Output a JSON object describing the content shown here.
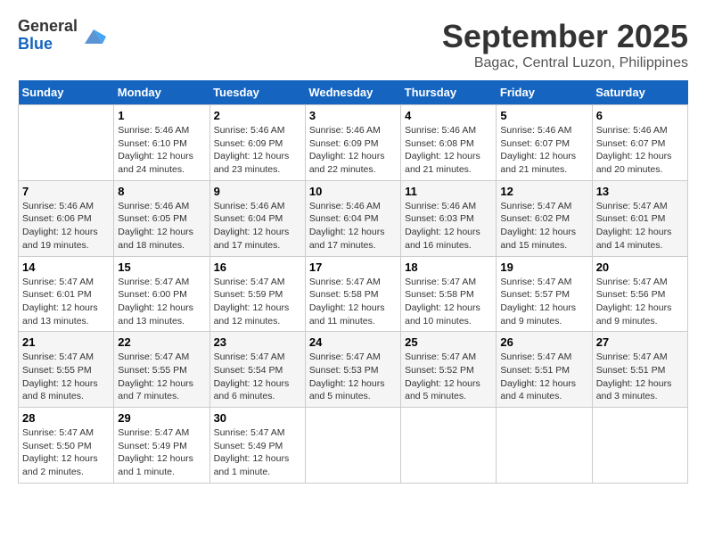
{
  "logo": {
    "general": "General",
    "blue": "Blue"
  },
  "title": {
    "month": "September 2025",
    "location": "Bagac, Central Luzon, Philippines"
  },
  "weekdays": [
    "Sunday",
    "Monday",
    "Tuesday",
    "Wednesday",
    "Thursday",
    "Friday",
    "Saturday"
  ],
  "weeks": [
    [
      {
        "day": "",
        "empty": true
      },
      {
        "day": "1",
        "sunrise": "5:46 AM",
        "sunset": "6:10 PM",
        "daylight": "12 hours and 24 minutes."
      },
      {
        "day": "2",
        "sunrise": "5:46 AM",
        "sunset": "6:09 PM",
        "daylight": "12 hours and 23 minutes."
      },
      {
        "day": "3",
        "sunrise": "5:46 AM",
        "sunset": "6:09 PM",
        "daylight": "12 hours and 22 minutes."
      },
      {
        "day": "4",
        "sunrise": "5:46 AM",
        "sunset": "6:08 PM",
        "daylight": "12 hours and 21 minutes."
      },
      {
        "day": "5",
        "sunrise": "5:46 AM",
        "sunset": "6:07 PM",
        "daylight": "12 hours and 21 minutes."
      },
      {
        "day": "6",
        "sunrise": "5:46 AM",
        "sunset": "6:07 PM",
        "daylight": "12 hours and 20 minutes."
      }
    ],
    [
      {
        "day": "7",
        "sunrise": "5:46 AM",
        "sunset": "6:06 PM",
        "daylight": "12 hours and 19 minutes."
      },
      {
        "day": "8",
        "sunrise": "5:46 AM",
        "sunset": "6:05 PM",
        "daylight": "12 hours and 18 minutes."
      },
      {
        "day": "9",
        "sunrise": "5:46 AM",
        "sunset": "6:04 PM",
        "daylight": "12 hours and 17 minutes."
      },
      {
        "day": "10",
        "sunrise": "5:46 AM",
        "sunset": "6:04 PM",
        "daylight": "12 hours and 17 minutes."
      },
      {
        "day": "11",
        "sunrise": "5:46 AM",
        "sunset": "6:03 PM",
        "daylight": "12 hours and 16 minutes."
      },
      {
        "day": "12",
        "sunrise": "5:47 AM",
        "sunset": "6:02 PM",
        "daylight": "12 hours and 15 minutes."
      },
      {
        "day": "13",
        "sunrise": "5:47 AM",
        "sunset": "6:01 PM",
        "daylight": "12 hours and 14 minutes."
      }
    ],
    [
      {
        "day": "14",
        "sunrise": "5:47 AM",
        "sunset": "6:01 PM",
        "daylight": "12 hours and 13 minutes."
      },
      {
        "day": "15",
        "sunrise": "5:47 AM",
        "sunset": "6:00 PM",
        "daylight": "12 hours and 13 minutes."
      },
      {
        "day": "16",
        "sunrise": "5:47 AM",
        "sunset": "5:59 PM",
        "daylight": "12 hours and 12 minutes."
      },
      {
        "day": "17",
        "sunrise": "5:47 AM",
        "sunset": "5:58 PM",
        "daylight": "12 hours and 11 minutes."
      },
      {
        "day": "18",
        "sunrise": "5:47 AM",
        "sunset": "5:58 PM",
        "daylight": "12 hours and 10 minutes."
      },
      {
        "day": "19",
        "sunrise": "5:47 AM",
        "sunset": "5:57 PM",
        "daylight": "12 hours and 9 minutes."
      },
      {
        "day": "20",
        "sunrise": "5:47 AM",
        "sunset": "5:56 PM",
        "daylight": "12 hours and 9 minutes."
      }
    ],
    [
      {
        "day": "21",
        "sunrise": "5:47 AM",
        "sunset": "5:55 PM",
        "daylight": "12 hours and 8 minutes."
      },
      {
        "day": "22",
        "sunrise": "5:47 AM",
        "sunset": "5:55 PM",
        "daylight": "12 hours and 7 minutes."
      },
      {
        "day": "23",
        "sunrise": "5:47 AM",
        "sunset": "5:54 PM",
        "daylight": "12 hours and 6 minutes."
      },
      {
        "day": "24",
        "sunrise": "5:47 AM",
        "sunset": "5:53 PM",
        "daylight": "12 hours and 5 minutes."
      },
      {
        "day": "25",
        "sunrise": "5:47 AM",
        "sunset": "5:52 PM",
        "daylight": "12 hours and 5 minutes."
      },
      {
        "day": "26",
        "sunrise": "5:47 AM",
        "sunset": "5:51 PM",
        "daylight": "12 hours and 4 minutes."
      },
      {
        "day": "27",
        "sunrise": "5:47 AM",
        "sunset": "5:51 PM",
        "daylight": "12 hours and 3 minutes."
      }
    ],
    [
      {
        "day": "28",
        "sunrise": "5:47 AM",
        "sunset": "5:50 PM",
        "daylight": "12 hours and 2 minutes."
      },
      {
        "day": "29",
        "sunrise": "5:47 AM",
        "sunset": "5:49 PM",
        "daylight": "12 hours and 1 minute."
      },
      {
        "day": "30",
        "sunrise": "5:47 AM",
        "sunset": "5:49 PM",
        "daylight": "12 hours and 1 minute."
      },
      {
        "day": "",
        "empty": true
      },
      {
        "day": "",
        "empty": true
      },
      {
        "day": "",
        "empty": true
      },
      {
        "day": "",
        "empty": true
      }
    ]
  ]
}
